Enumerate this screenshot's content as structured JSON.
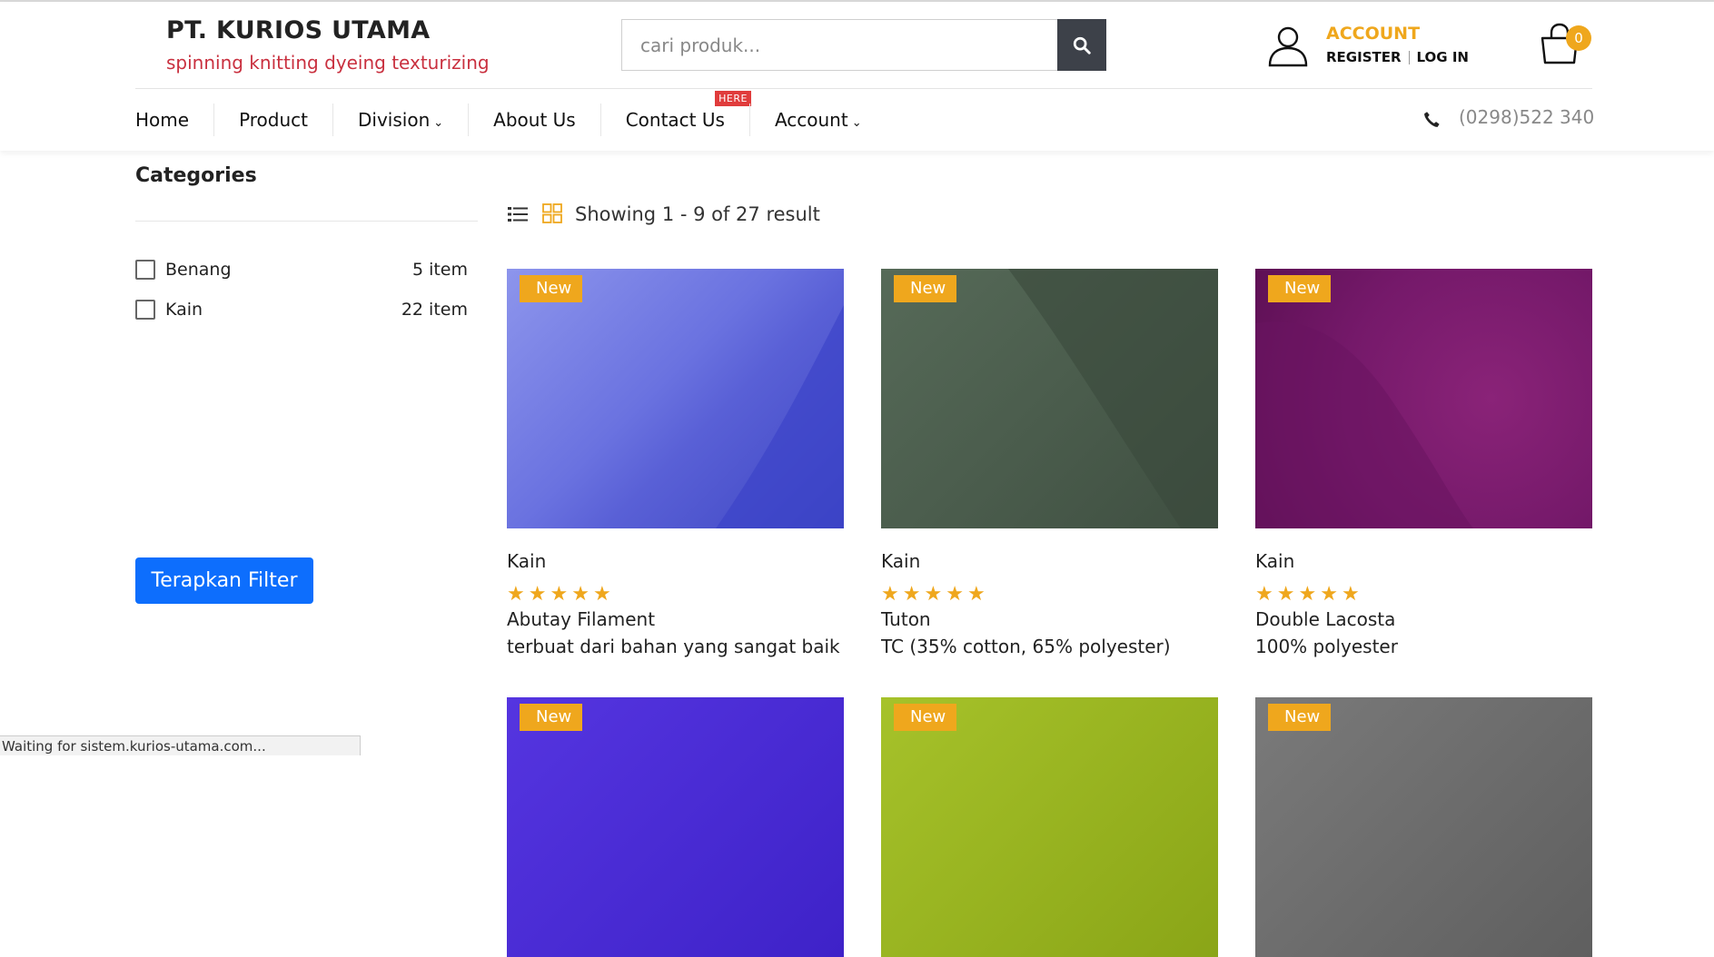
{
  "brand": {
    "title": "PT. KURIOS UTAMA",
    "tagline": "spinning knitting dyeing texturizing"
  },
  "search": {
    "placeholder": "cari produk..."
  },
  "account": {
    "title": "ACCOUNT",
    "register": "REGISTER",
    "login": "LOG IN"
  },
  "cart": {
    "count": "0"
  },
  "nav": {
    "items": [
      {
        "label": "Home"
      },
      {
        "label": "Product"
      },
      {
        "label": "Division",
        "caret": "⌄"
      },
      {
        "label": "About Us"
      },
      {
        "label": "Contact Us",
        "badge": "HERE"
      },
      {
        "label": "Account",
        "caret": "⌄"
      }
    ],
    "phone": "(0298)522 340"
  },
  "sidebar": {
    "title": "Categories",
    "categories": [
      {
        "label": "Benang",
        "count": "5 item"
      },
      {
        "label": "Kain",
        "count": "22 item"
      }
    ],
    "filter_button": "Terapkan Filter"
  },
  "results": {
    "summary": "Showing 1 - 9 of 27 result"
  },
  "products": [
    {
      "badge": "New",
      "category": "Kain",
      "rating": 5,
      "name": "Abutay Filament",
      "desc": "terbuat dari bahan yang sangat baik",
      "color": "#5a62d6"
    },
    {
      "badge": "New",
      "category": "Kain",
      "rating": 5,
      "name": "Tuton",
      "desc": "TC (35% cotton, 65% polyester)",
      "color": "#4d5f4f"
    },
    {
      "badge": "New",
      "category": "Kain",
      "rating": 5,
      "name": "Double Lacosta",
      "desc": "100% polyester",
      "color": "#7a1a68"
    },
    {
      "badge": "New",
      "color": "#4a2bd4"
    },
    {
      "badge": "New",
      "color": "#97b31c"
    },
    {
      "badge": "New",
      "color": "#6e6e6e"
    }
  ],
  "status_bar": "Waiting for sistem.kurios-utama.com..."
}
